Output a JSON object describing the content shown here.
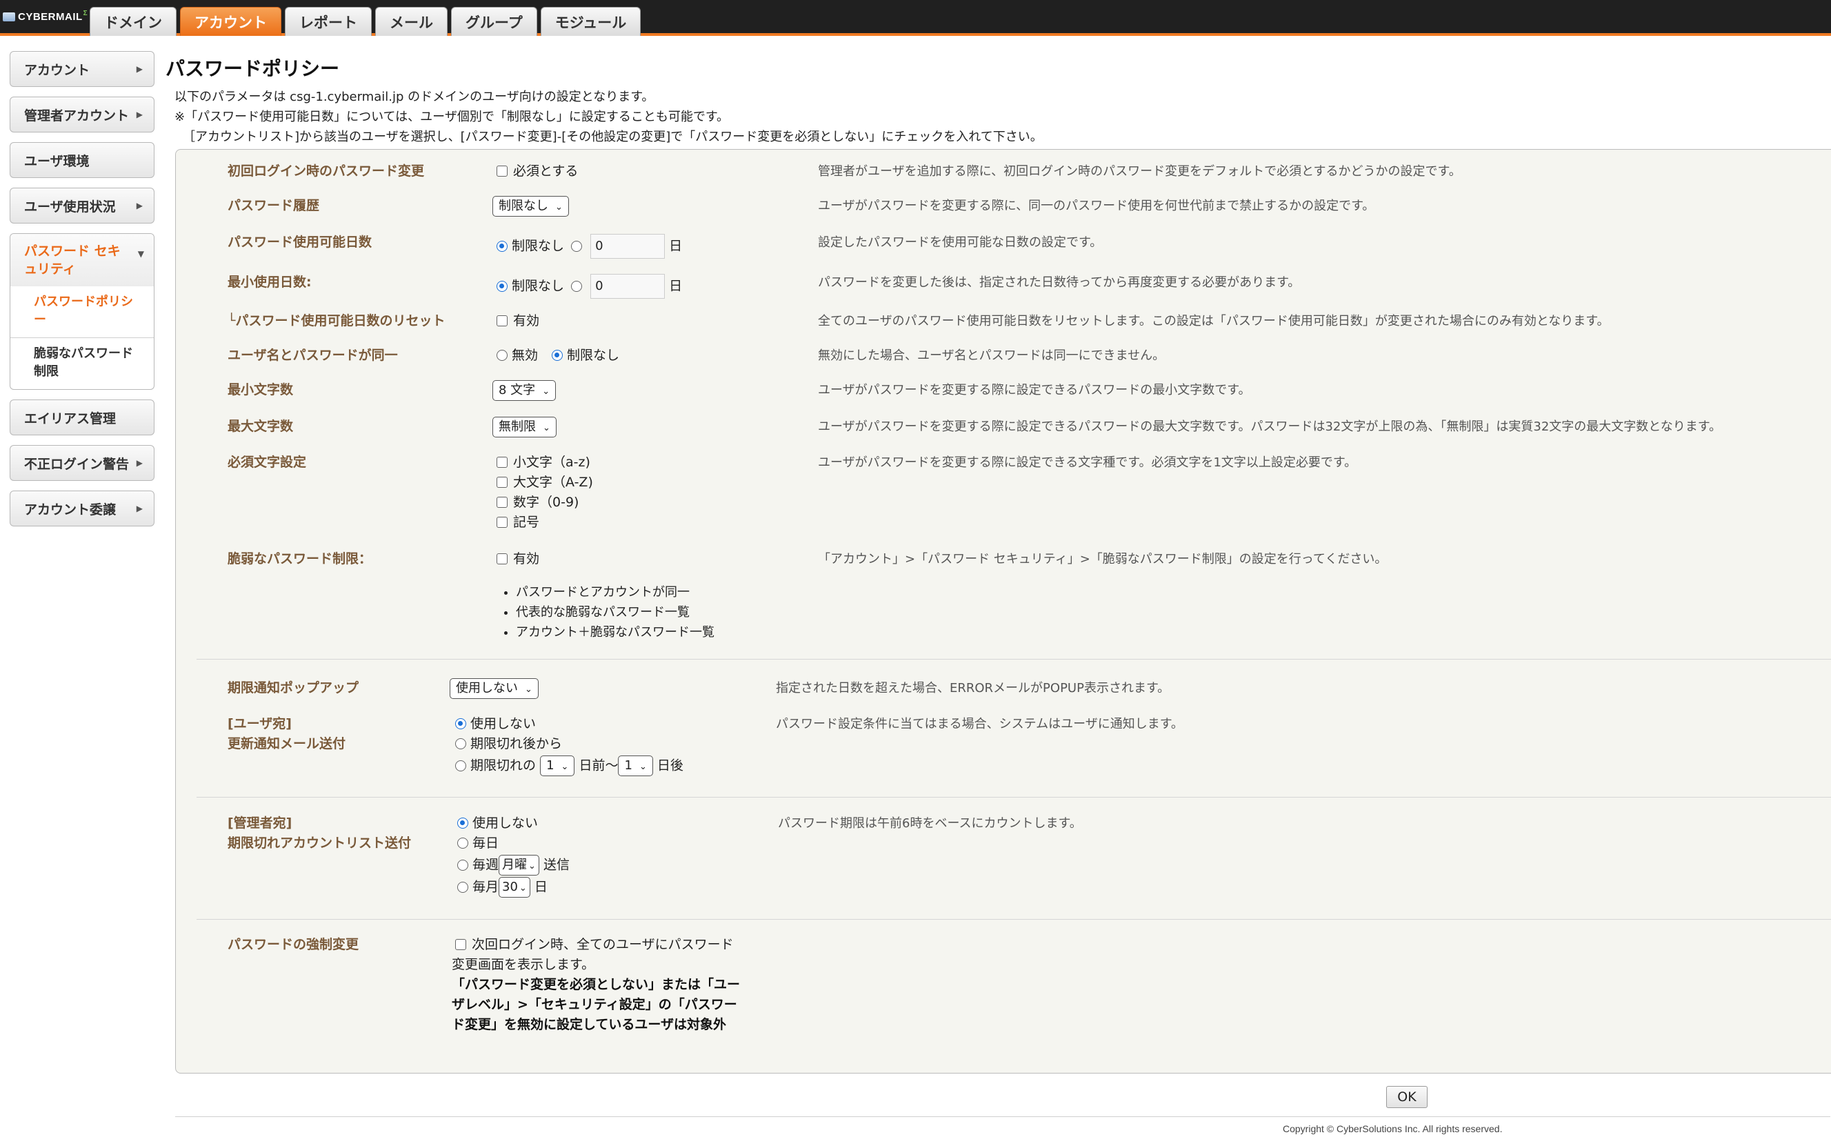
{
  "app": {
    "logo": "CYBERMAIL",
    "logo_suffix": "Σ"
  },
  "tabs": [
    "ドメイン",
    "アカウント",
    "レポート",
    "メール",
    "グループ",
    "モジュール"
  ],
  "sidebar": {
    "items": [
      "アカウント",
      "管理者アカウント",
      "ユーザ環境",
      "ユーザ使用状況"
    ],
    "group": {
      "title": "パスワード セキュリティ",
      "subs": [
        "パスワードポリシー",
        "脆弱なパスワード制限"
      ]
    },
    "items_after": [
      "エイリアス管理",
      "不正ログイン警告",
      "アカウント委譲"
    ]
  },
  "page": {
    "title": "パスワードポリシー",
    "intro": [
      "以下のパラメータは csg-1.cybermail.jp のドメインのユーザ向けの設定となります。",
      "※「パスワード使用可能日数」については、ユーザ個別で「制限なし」に設定することも可能です。",
      "［アカウントリスト]から該当のユーザを選択し、[パスワード変更]-[その他設定の変更]で「パスワード変更を必須としない」にチェックを入れて下さい。"
    ]
  },
  "rows": {
    "first_login": {
      "label": "初回ログイン時のパスワード変更",
      "option": "必須とする",
      "desc": "管理者がユーザを追加する際に、初回ログイン時のパスワード変更をデフォルトで必須とするかどうかの設定です。"
    },
    "history": {
      "label": "パスワード履歴",
      "value": "制限なし",
      "desc": "ユーザがパスワードを変更する際に、同一のパスワード使用を何世代前まで禁止するかの設定です。"
    },
    "max_days": {
      "label": "パスワード使用可能日数",
      "opt_none": "制限なし",
      "value": "0",
      "unit": "日",
      "desc": "設定したパスワードを使用可能な日数の設定です。"
    },
    "min_days": {
      "label": "最小使用日数:",
      "opt_none": "制限なし",
      "value": "0",
      "unit": "日",
      "desc": "パスワードを変更した後は、指定された日数待ってから再度変更する必要があります。"
    },
    "reset": {
      "label": "└パスワード使用可能日数のリセット",
      "option": "有効",
      "desc": "全てのユーザのパスワード使用可能日数をリセットします。この設定は「パスワード使用可能日数」が変更された場合にのみ有効となります。"
    },
    "same_name": {
      "label": "ユーザ名とパスワードが同一",
      "opt1": "無効",
      "opt2": "制限なし",
      "desc": "無効にした場合、ユーザ名とパスワードは同一にできません。"
    },
    "min_len": {
      "label": "最小文字数",
      "value": "8 文字",
      "desc": "ユーザがパスワードを変更する際に設定できるパスワードの最小文字数です。"
    },
    "max_len": {
      "label": "最大文字数",
      "value": "無制限",
      "desc": "ユーザがパスワードを変更する際に設定できるパスワードの最大文字数です。パスワードは32文字が上限の為、「無制限」は実質32文字の最大文字数となります。"
    },
    "required": {
      "label": "必須文字設定",
      "options": [
        "小文字（a-z)",
        "大文字（A-Z)",
        "数字（0-9)",
        "記号"
      ],
      "desc": "ユーザがパスワードを変更する際に設定できる文字種です。必須文字を1文字以上設定必要です。"
    },
    "weak": {
      "label": "脆弱なパスワード制限：",
      "option": "有効",
      "bullets": [
        "パスワードとアカウントが同一",
        "代表的な脆弱なパスワード一覧",
        "アカウント＋脆弱なパスワード一覧"
      ],
      "desc": "「アカウント」>「パスワード セキュリティ」>「脆弱なパスワード制限」の設定を行ってください。"
    },
    "popup": {
      "label": "期限通知ポップアップ",
      "value": "使用しない",
      "desc": "指定された日数を超えた場合、ERRORメールがPOPUP表示されます。"
    },
    "user_mail": {
      "label1": "[ユーザ宛]",
      "label2": "更新通知メール送付",
      "opt1": "使用しない",
      "opt2": "期限切れ後から",
      "opt3_pre": "期限切れの",
      "sel1": "1",
      "mid": "日前〜",
      "sel2": "1",
      "post": "日後",
      "desc": "パスワード設定条件に当てはまる場合、システムはユーザに通知します。"
    },
    "admin_mail": {
      "label1": "[管理者宛]",
      "label2": "期限切れアカウントリスト送付",
      "opt1": "使用しない",
      "opt2": "毎日",
      "opt3": "毎週",
      "weekday": "月曜",
      "send": "送信",
      "opt4": "毎月",
      "day": "30",
      "day_unit": "日",
      "desc": "パスワード期限は午前6時をベースにカウントします。"
    },
    "force": {
      "label": "パスワードの強制変更",
      "text": "次回ログイン時、全てのユーザにパスワード変更画面を表示します。",
      "note": "「パスワード変更を必須としない」または「ユーザレベル」>「セキュリティ設定」の「パスワード変更」を無効に設定しているユーザは対象外"
    }
  },
  "ok_label": "OK",
  "copyright": "Copyright © CyberSolutions Inc. All rights reserved."
}
